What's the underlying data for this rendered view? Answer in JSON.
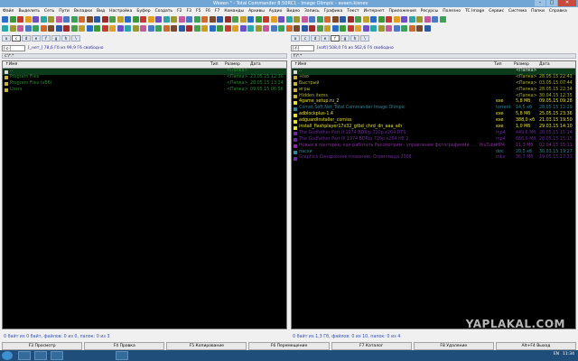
{
  "window": {
    "title": "Weeen ³ - Total Commander 8.50RC1 - Image Olimpic - aveen.kisnev"
  },
  "menu": [
    "Файл",
    "Выделить",
    "Сеть",
    "Пути",
    "Вкладки",
    "Вид",
    "Настройка",
    "Буфер",
    "Создать",
    "F2",
    "F3",
    "F5",
    "F6",
    "F7",
    "Команды",
    "Архивы",
    "Аудио",
    "Видео",
    "Запись",
    "Графика",
    "Текст",
    "Интернет",
    "Приложения",
    "Ресурсы",
    "Полезно",
    "TC Image",
    "Сервис",
    "Система",
    "Папки",
    "Справка"
  ],
  "left_panel": {
    "drive_selector": "[-c-]",
    "free_space": "[_нет_]  78,6 Гб из 99,9 Гб свободно",
    "tab": "c:\\*.*",
    "columns": {
      "name": "↑Имя",
      "type": "Тип",
      "size": "Размер",
      "date": "Дата"
    },
    "rows": [
      {
        "name": "..",
        "type": "",
        "size": "<Папка>",
        "date": ""
      },
      {
        "name": "Program Files",
        "type": "",
        "size": "<Папка>",
        "date": "23.05.15 12:30"
      },
      {
        "name": "Program Files (x86)",
        "type": "",
        "size": "<Папка>",
        "date": "28.05.15 13:24"
      },
      {
        "name": "Users",
        "type": "",
        "size": "<Папка>",
        "date": "09.05.15 06:56"
      }
    ],
    "status": "0 байт из 0 байт, файлов: 0 из 0, папок: 0 из 3"
  },
  "right_panel": {
    "drive_selector": "[-f-]",
    "free_space": "[soft]  508,0 Гб из 562,6 Гб свободно",
    "tab": "f:\\*.*",
    "columns": {
      "name": "↑Имя",
      "type": "Тип",
      "size": "Размер",
      "date": "Дата"
    },
    "rows": [
      {
        "name": "..",
        "type": "",
        "size": "<Папка>",
        "date": "",
        "color": "#d8d8d8"
      },
      {
        "name": "+iso",
        "type": "",
        "size": "<Папка>",
        "date": "28.05.15 22:43",
        "color": "#b0b028"
      },
      {
        "name": "Быстрый",
        "type": "",
        "size": "<Папка>",
        "date": "03.05.15 07:44",
        "color": "#b0b028"
      },
      {
        "name": "игры",
        "type": "",
        "size": "<Папка>",
        "date": "28.05.15 22:34",
        "color": "#b0b028"
      },
      {
        "name": "Hidden items",
        "type": "",
        "size": "<Папка>",
        "date": "30.04.15 12:35",
        "color": "#b0b028"
      },
      {
        "name": "4game_setup.ru_2",
        "type": "exe",
        "size": "5,8 Мб",
        "date": "09.05.15 09:28",
        "color": "#e8e030"
      },
      {
        "name": "Comet.Soft.Net_Total Commander Image Olimpic",
        "type": "torrent",
        "size": "14,5 кб",
        "date": "28.05.15 12:29",
        "color": "#2a8a9a"
      },
      {
        "name": "adblockplus-1.4",
        "type": "exe",
        "size": "5,8 Мб",
        "date": "25.05.15 23:36",
        "color": "#e8e030"
      },
      {
        "name": "adguardInstaller_corniss",
        "type": "exe",
        "size": "388,0 кб",
        "date": "21.03.15 19:50",
        "color": "#e8e030"
      },
      {
        "name": "install_flashplayer17x32_gtbd_chrd_dn_aaa_aih",
        "type": "exe",
        "size": "1,0 Мб",
        "date": "29.03.15 14:10",
        "color": "#e8e030"
      },
      {
        "name": "The Godfather Part II 1974 BDRip 720p x264 DTS",
        "type": "mp4",
        "size": "449,6 Мб",
        "date": "28.05.15 15:14",
        "color": "#6a2a9a"
      },
      {
        "name": "The Godfather Part III 1974 BDRip 720p x264 HE 2",
        "type": "mp4",
        "size": "666,0 Мб",
        "date": "28.05.15 15:15",
        "color": "#6a2a9a"
      },
      {
        "name": "Новые в пантерке, как работать Рассмотрим - управление фотографиями . . . YouTube",
        "type": "MP4",
        "size": "11,3 Мб",
        "date": "02.04.15 15:11",
        "color": "#8a2aa0"
      },
      {
        "name": "пасхи",
        "type": "doc",
        "size": "20,5 кб",
        "date": "30.03.15 19:27",
        "color": "#2a8a9a"
      },
      {
        "name": "Graphics Синхронное плавание. Олимпиада 2008",
        "type": "mkv",
        "size": "36,7 Мб",
        "date": "19.05.15 17:33",
        "color": "#6a2a9a"
      }
    ],
    "status": "0 байт из 1,3 Гб, файлов: 0 из 10, папок: 0 из 4"
  },
  "fkeys": [
    "F3 Просмотр",
    "F4 Правка",
    "F5 Копирование",
    "F6 Перемещение",
    "F7 Каталог",
    "F8 Удаление",
    "Alt+F4 Выход"
  ],
  "taskbar": {
    "language": "EN",
    "time": "11:34"
  },
  "watermark": {
    "text": "YAPLAKAL.COM"
  },
  "colors": {
    "panel_bg": "#000000",
    "folder_text": "#1f8f2a",
    "exe_text": "#e8e030",
    "status_text": "#3050b8"
  }
}
